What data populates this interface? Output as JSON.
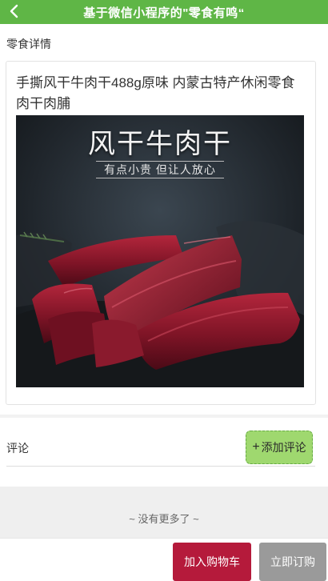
{
  "header": {
    "title": "基于微信小程序的\"零食有鸣“",
    "back_icon": "chevron-left-icon"
  },
  "section": {
    "label": "零食详情"
  },
  "product": {
    "title": "手撕风干牛肉干488g原味 内蒙古特产休闲零食 肉干肉脯",
    "image_headline": "风干牛肉干",
    "image_slogan": "有点小贵 但让人放心"
  },
  "comments": {
    "label": "评论",
    "add_plus": "+",
    "add_label": "添加评论"
  },
  "footer": {
    "no_more": "~ 没有更多了 ~"
  },
  "actions": {
    "add_to_cart": "加入购物车",
    "buy_now": "立即订购"
  },
  "colors": {
    "header_green": "#5fb646",
    "add_comment_green": "#9fd86f",
    "cart_red": "#b51a3b",
    "buy_gray": "#9a9a9a"
  }
}
